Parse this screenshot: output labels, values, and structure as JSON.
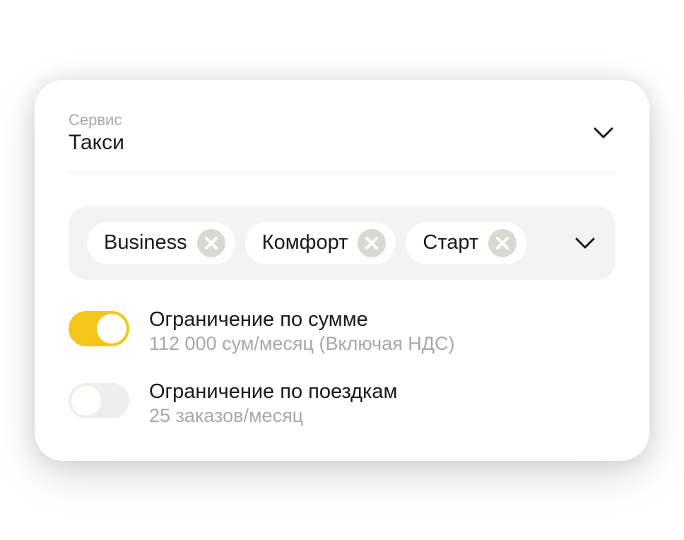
{
  "service": {
    "label": "Сервис",
    "value": "Такси"
  },
  "chips": [
    {
      "label": "Business"
    },
    {
      "label": "Комфорт"
    },
    {
      "label": "Старт"
    }
  ],
  "settings": [
    {
      "title": "Ограничение по сумме",
      "subtitle": "112 000 сум/месяц (Включая НДС)",
      "enabled": true
    },
    {
      "title": "Ограничение по поездкам",
      "subtitle": "25 заказов/месяц",
      "enabled": false
    }
  ]
}
